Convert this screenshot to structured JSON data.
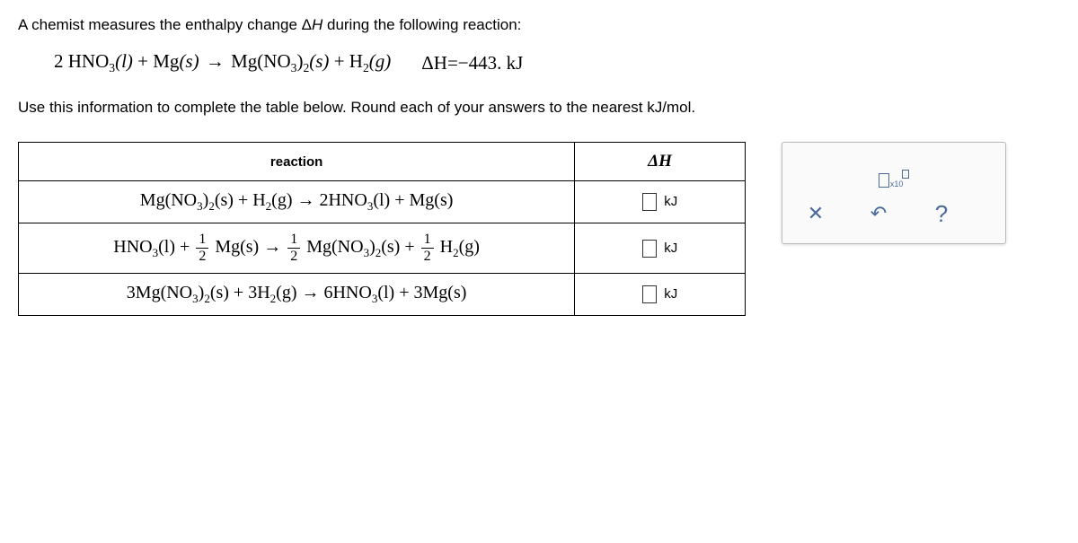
{
  "question": {
    "intro_before": "A chemist measures the enthalpy change Δ",
    "intro_var": "H",
    "intro_after": " during the following reaction:",
    "instruction": "Use this information to complete the table below. Round each of your answers to the nearest kJ/mol."
  },
  "given_equation": {
    "lhs_a": "2 HNO",
    "lhs_a_sub": "3",
    "lhs_a_phase": "(l)",
    "plus1": " + ",
    "lhs_b": "Mg",
    "lhs_b_phase": "(s)",
    "arrow": "→",
    "rhs_a": "Mg(NO",
    "rhs_a_sub1": "3",
    "rhs_a_sub2_close": ")",
    "rhs_a_sub2": "2",
    "rhs_a_phase": "(s)",
    "plus2": " + ",
    "rhs_b": "H",
    "rhs_b_sub": "2",
    "rhs_b_phase": "(g)",
    "dh_label": "ΔH=",
    "dh_value": "−443. kJ"
  },
  "table": {
    "headers": {
      "reaction": "reaction",
      "dh_prefix": "Δ",
      "dh_var": "H"
    },
    "rows": [
      {
        "unit": "kJ"
      },
      {
        "unit": "kJ"
      },
      {
        "unit": "kJ"
      }
    ]
  },
  "reactions_text": {
    "r1": {
      "a": "Mg(NO",
      "a_s1": "3",
      "a_close": ")",
      "a_s2": "2",
      "a_ph": "(s)",
      "p1": " + ",
      "b": "H",
      "b_s": "2",
      "b_ph": "(g)",
      "arr": " → ",
      "c": "2HNO",
      "c_s": "3",
      "c_ph": "(l)",
      "p2": " + ",
      "d": "Mg",
      "d_ph": "(s)"
    },
    "r2": {
      "a": "HNO",
      "a_s": "3",
      "a_ph": "(l)",
      "p1": " + ",
      "f1n": "1",
      "f1d": "2",
      "b": "Mg",
      "b_ph": "(s)",
      "arr": " → ",
      "f2n": "1",
      "f2d": "2",
      "c": "Mg(NO",
      "c_s1": "3",
      "c_close": ")",
      "c_s2": "2",
      "c_ph": "(s)",
      "p2": " + ",
      "f3n": "1",
      "f3d": "2",
      "d": "H",
      "d_s": "2",
      "d_ph": "(g)"
    },
    "r3": {
      "a": "3Mg(NO",
      "a_s1": "3",
      "a_close": ")",
      "a_s2": "2",
      "a_ph": "(s)",
      "p1": " + ",
      "b": "3H",
      "b_s": "2",
      "b_ph": "(g)",
      "arr": " → ",
      "c": "6HNO",
      "c_s": "3",
      "c_ph": "(l)",
      "p2": " + ",
      "d": "3Mg",
      "d_ph": "(s)"
    }
  },
  "toolbar": {
    "sci_label": "x10",
    "clear": "✕",
    "undo": "↶",
    "help": "?"
  }
}
